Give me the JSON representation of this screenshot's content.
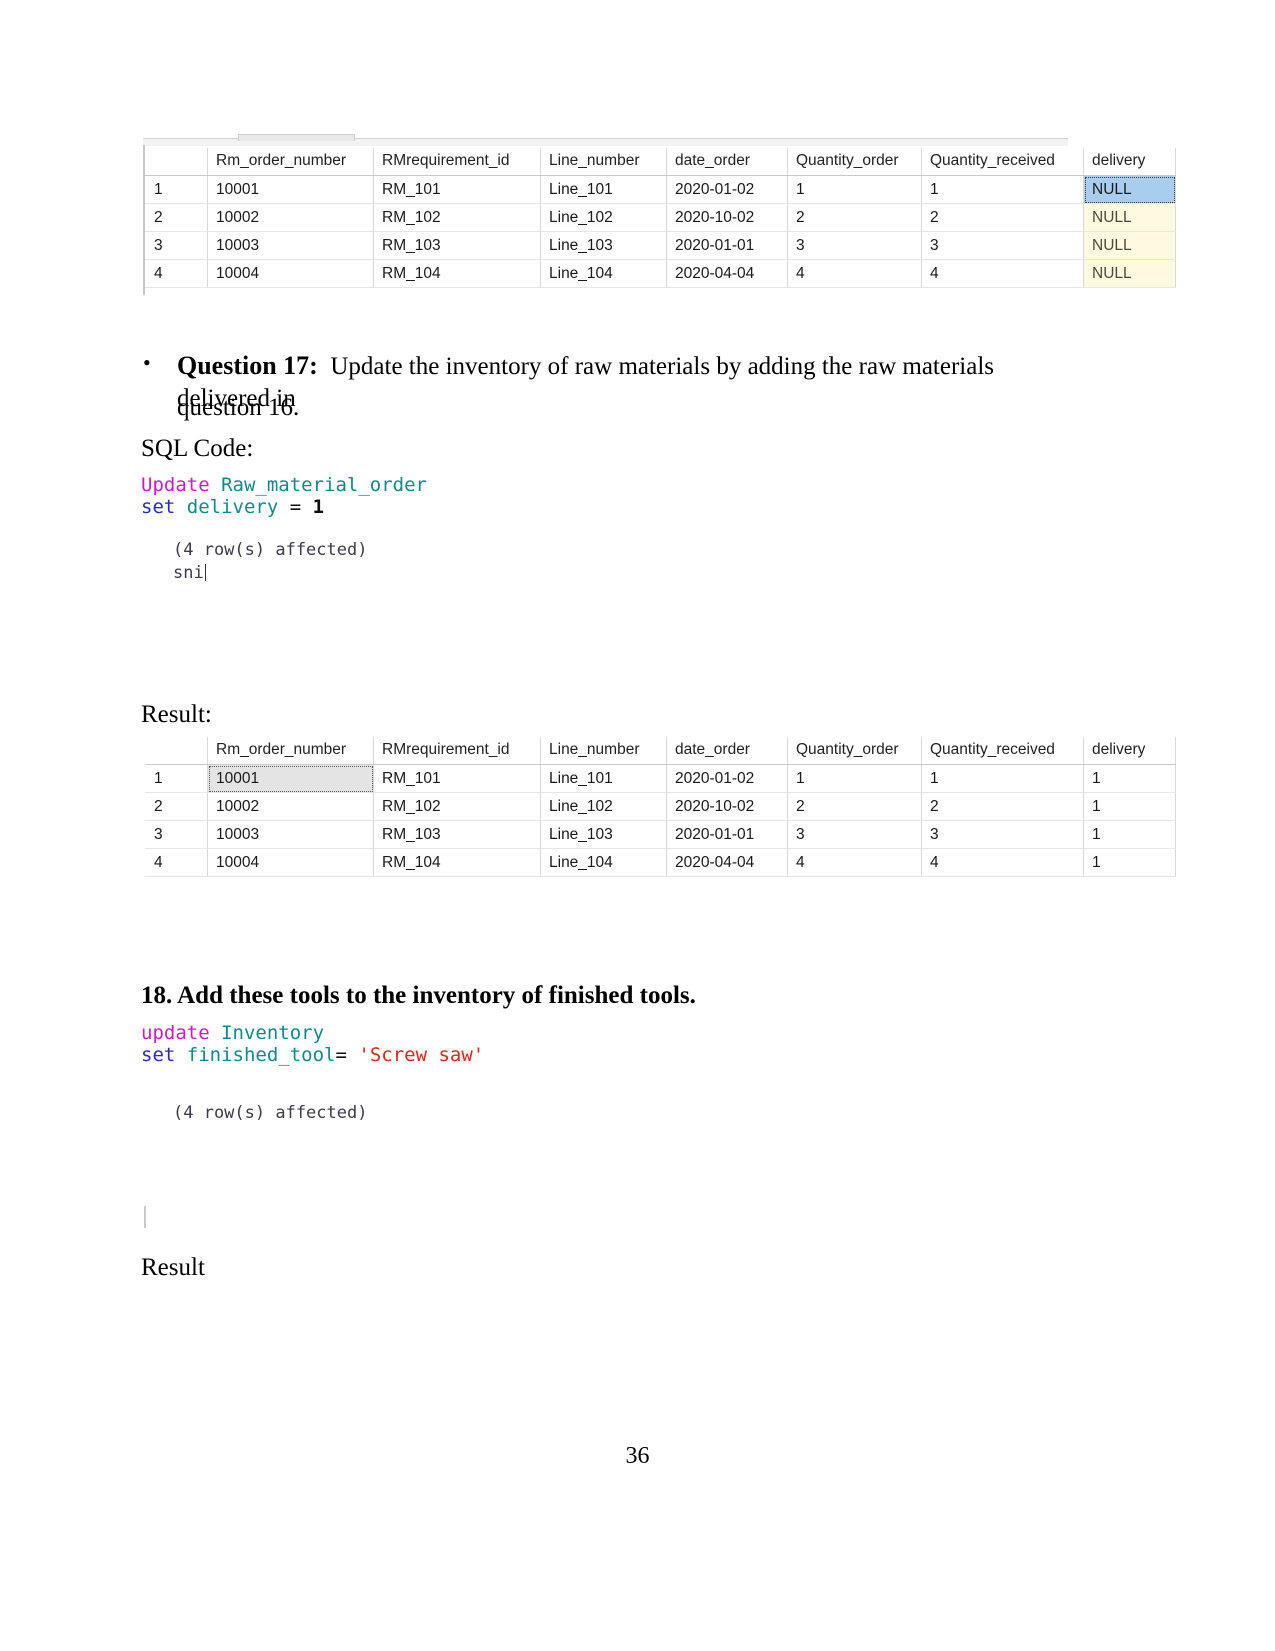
{
  "page": {
    "number": "36"
  },
  "table_before": {
    "name": "raw-material-order-before",
    "columns": [
      "",
      "Rm_order_number",
      "RMrequirement_id",
      "Line_number",
      "date_order",
      "Quantity_order",
      "Quantity_received",
      "delivery"
    ],
    "rows": [
      {
        "n": "1",
        "rm_order_number": "10001",
        "rmrequirement_id": "RM_101",
        "line_number": "Line_101",
        "date_order": "2020-01-02",
        "quantity_order": "1",
        "quantity_received": "1",
        "delivery": "NULL"
      },
      {
        "n": "2",
        "rm_order_number": "10002",
        "rmrequirement_id": "RM_102",
        "line_number": "Line_102",
        "date_order": "2020-10-02",
        "quantity_order": "2",
        "quantity_received": "2",
        "delivery": "NULL"
      },
      {
        "n": "3",
        "rm_order_number": "10003",
        "rmrequirement_id": "RM_103",
        "line_number": "Line_103",
        "date_order": "2020-01-01",
        "quantity_order": "3",
        "quantity_received": "3",
        "delivery": "NULL"
      },
      {
        "n": "4",
        "rm_order_number": "10004",
        "rmrequirement_id": "RM_104",
        "line_number": "Line_104",
        "date_order": "2020-04-04",
        "quantity_order": "4",
        "quantity_received": "4",
        "delivery": "NULL"
      }
    ]
  },
  "question17": {
    "bullet": "•",
    "label": "Question 17:",
    "body_line1": "Update the inventory of raw materials by adding the raw materials delivered in",
    "body_line2": "question 16.",
    "sql_code_label": "SQL Code:",
    "sql": {
      "line1_kw": "Update",
      "line1_table": "Raw_material_order",
      "line2_kw": "set",
      "line2_col": "delivery",
      "line2_op": "=",
      "line2_val": "1"
    },
    "output_message": "(4 row(s) affected)",
    "typed_text": "sni",
    "result_label": "Result:"
  },
  "table_after": {
    "name": "raw-material-order-after",
    "columns": [
      "",
      "Rm_order_number",
      "RMrequirement_id",
      "Line_number",
      "date_order",
      "Quantity_order",
      "Quantity_received",
      "delivery"
    ],
    "rows": [
      {
        "n": "1",
        "rm_order_number": "10001",
        "rmrequirement_id": "RM_101",
        "line_number": "Line_101",
        "date_order": "2020-01-02",
        "quantity_order": "1",
        "quantity_received": "1",
        "delivery": "1"
      },
      {
        "n": "2",
        "rm_order_number": "10002",
        "rmrequirement_id": "RM_102",
        "line_number": "Line_102",
        "date_order": "2020-10-02",
        "quantity_order": "2",
        "quantity_received": "2",
        "delivery": "1"
      },
      {
        "n": "3",
        "rm_order_number": "10003",
        "rmrequirement_id": "RM_103",
        "line_number": "Line_103",
        "date_order": "2020-01-01",
        "quantity_order": "3",
        "quantity_received": "3",
        "delivery": "1"
      },
      {
        "n": "4",
        "rm_order_number": "10004",
        "rmrequirement_id": "RM_104",
        "line_number": "Line_104",
        "date_order": "2020-04-04",
        "quantity_order": "4",
        "quantity_received": "4",
        "delivery": "1"
      }
    ]
  },
  "question18": {
    "heading": "18. Add these tools to the inventory of finished tools.",
    "sql": {
      "line1_kw": "update",
      "line1_table": "Inventory",
      "line2_kw": "set",
      "line2_col": "finished_tool",
      "line2_op": "=",
      "line2_val": "'Screw saw'"
    },
    "output_message": "(4 row(s) affected)",
    "result_label": "Result"
  }
}
